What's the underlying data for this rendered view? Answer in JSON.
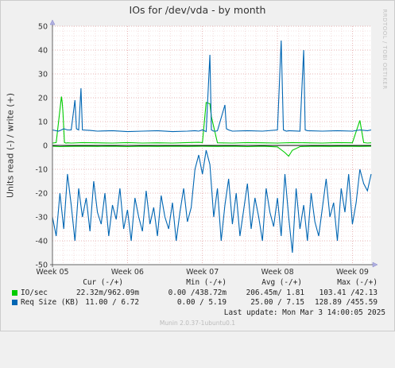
{
  "title": "IOs for /dev/vda - by month",
  "side_text": "RRDTOOL / TOBI OETIKER",
  "legend": {
    "headers": [
      "Cur (-/+)",
      "Min (-/+)",
      "Avg (-/+)",
      "Max (-/+)"
    ],
    "rows": [
      {
        "name": "IO/sec",
        "color": "#00cc00",
        "cur": "22.32m/962.09m",
        "min": "0.00 /438.72m",
        "avg": "206.45m/ 1.81",
        "max": "103.41 /42.13"
      },
      {
        "name": "Req Size (KB)",
        "color": "#0066b3",
        "cur": "11.00 / 6.72",
        "min": "0.00 / 5.19",
        "avg": "25.00 / 7.15",
        "max": "128.89 /455.59"
      }
    ]
  },
  "last_update": "Last update: Mon Mar  3 14:00:05 2025",
  "footer": "Munin 2.0.37-1ubuntu0.1",
  "chart_data": {
    "type": "line",
    "title": "IOs for /dev/vda - by month",
    "ylabel": "Units read (-) / write (+)",
    "ylim": [
      -50,
      50
    ],
    "yticks": [
      -50,
      -40,
      -30,
      -20,
      -10,
      0,
      10,
      20,
      30,
      40,
      50
    ],
    "xticks": [
      "Week 05",
      "Week 06",
      "Week 07",
      "Week 08",
      "Week 09"
    ],
    "x_range_weeks": [
      0,
      4.25
    ],
    "grid": true,
    "series": [
      {
        "name": "IO/sec",
        "color": "#00cc00",
        "direction": "write",
        "x": [
          0.0,
          0.05,
          0.12,
          0.13,
          0.14,
          0.16,
          0.18,
          0.2,
          0.25,
          0.4,
          0.6,
          0.8,
          1.0,
          1.2,
          1.4,
          1.6,
          1.8,
          1.95,
          2.0,
          2.05,
          2.1,
          2.12,
          2.2,
          2.4,
          2.6,
          2.8,
          3.0,
          3.2,
          3.4,
          3.6,
          3.8,
          4.0,
          4.1,
          4.15,
          4.2,
          4.25
        ],
        "y": [
          1.0,
          1.2,
          20.5,
          18.0,
          14.0,
          1.2,
          1.0,
          1.1,
          1.0,
          1.2,
          1.1,
          1.0,
          1.2,
          1.0,
          1.1,
          1.0,
          1.2,
          1.3,
          1.2,
          18.0,
          17.5,
          12.0,
          1.1,
          1.0,
          1.2,
          1.1,
          1.0,
          1.2,
          1.1,
          1.0,
          1.2,
          1.1,
          10.5,
          1.2,
          1.0,
          1.1
        ]
      },
      {
        "name": "IO/sec",
        "color": "#00cc00",
        "direction": "read",
        "x": [
          0.0,
          0.1,
          0.2,
          0.4,
          0.6,
          0.8,
          1.0,
          1.2,
          1.4,
          1.6,
          1.8,
          2.0,
          2.2,
          2.4,
          2.6,
          2.8,
          3.0,
          3.1,
          3.15,
          3.2,
          3.3,
          3.5,
          3.7,
          3.9,
          4.1,
          4.25
        ],
        "y": [
          -0.3,
          -0.5,
          -0.4,
          -0.3,
          -0.4,
          -0.3,
          -0.5,
          -0.3,
          -0.4,
          -0.3,
          -0.4,
          -0.3,
          -0.4,
          -0.3,
          -0.5,
          -0.3,
          -0.6,
          -3.0,
          -4.5,
          -2.0,
          -0.5,
          -0.3,
          -0.4,
          -0.3,
          -0.4,
          -0.3
        ]
      },
      {
        "name": "Req Size (KB)",
        "color": "#0066b3",
        "direction": "write",
        "x": [
          0.0,
          0.08,
          0.12,
          0.15,
          0.2,
          0.25,
          0.3,
          0.32,
          0.35,
          0.38,
          0.4,
          0.5,
          0.6,
          0.8,
          1.0,
          1.2,
          1.4,
          1.6,
          1.8,
          1.9,
          1.95,
          2.0,
          2.05,
          2.1,
          2.12,
          2.15,
          2.18,
          2.2,
          2.3,
          2.32,
          2.35,
          2.4,
          2.6,
          2.8,
          3.0,
          3.05,
          3.08,
          3.12,
          3.15,
          3.3,
          3.35,
          3.37,
          3.4,
          3.6,
          3.8,
          4.0,
          4.1,
          4.2,
          4.25
        ],
        "y": [
          6.5,
          6.0,
          6.5,
          7.0,
          6.5,
          6.5,
          19.0,
          7.0,
          6.5,
          24.0,
          6.5,
          6.3,
          6.0,
          6.2,
          5.8,
          6.0,
          6.2,
          5.8,
          6.0,
          6.2,
          6.0,
          6.5,
          5.8,
          38.0,
          6.5,
          6.0,
          6.0,
          6.2,
          17.0,
          7.0,
          6.5,
          6.0,
          6.2,
          6.0,
          6.5,
          44.0,
          6.5,
          6.0,
          6.2,
          6.0,
          40.0,
          6.5,
          6.2,
          6.0,
          6.2,
          6.0,
          6.5,
          6.2,
          6.5
        ]
      },
      {
        "name": "Req Size (KB)",
        "color": "#0066b3",
        "direction": "read",
        "x": [
          0.0,
          0.05,
          0.1,
          0.15,
          0.2,
          0.25,
          0.3,
          0.35,
          0.4,
          0.45,
          0.5,
          0.55,
          0.6,
          0.65,
          0.7,
          0.75,
          0.8,
          0.85,
          0.9,
          0.95,
          1.0,
          1.05,
          1.1,
          1.15,
          1.2,
          1.25,
          1.3,
          1.35,
          1.4,
          1.45,
          1.5,
          1.55,
          1.6,
          1.65,
          1.7,
          1.75,
          1.8,
          1.85,
          1.9,
          1.95,
          2.0,
          2.05,
          2.1,
          2.15,
          2.2,
          2.25,
          2.3,
          2.35,
          2.4,
          2.45,
          2.5,
          2.55,
          2.6,
          2.65,
          2.7,
          2.75,
          2.8,
          2.85,
          2.9,
          2.95,
          3.0,
          3.05,
          3.1,
          3.15,
          3.2,
          3.25,
          3.3,
          3.35,
          3.4,
          3.45,
          3.5,
          3.55,
          3.6,
          3.65,
          3.7,
          3.75,
          3.8,
          3.85,
          3.9,
          3.95,
          4.0,
          4.05,
          4.1,
          4.15,
          4.2,
          4.25
        ],
        "y": [
          -30,
          -38,
          -20,
          -35,
          -12,
          -25,
          -40,
          -18,
          -30,
          -22,
          -36,
          -15,
          -28,
          -33,
          -20,
          -38,
          -25,
          -31,
          -18,
          -35,
          -27,
          -40,
          -22,
          -30,
          -36,
          -19,
          -33,
          -26,
          -38,
          -21,
          -30,
          -35,
          -24,
          -40,
          -28,
          -18,
          -32,
          -26,
          -10,
          -4,
          -12,
          -2,
          -8,
          -30,
          -18,
          -40,
          -25,
          -14,
          -33,
          -20,
          -38,
          -27,
          -16,
          -35,
          -22,
          -30,
          -40,
          -18,
          -28,
          -34,
          -22,
          -38,
          -12,
          -30,
          -45,
          -18,
          -35,
          -25,
          -40,
          -20,
          -32,
          -38,
          -26,
          -14,
          -30,
          -24,
          -40,
          -18,
          -28,
          -12,
          -33,
          -24,
          -10,
          -16,
          -19,
          -12
        ]
      }
    ]
  }
}
